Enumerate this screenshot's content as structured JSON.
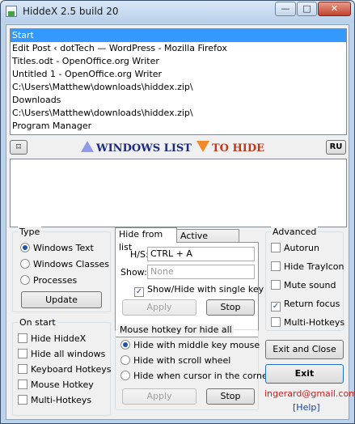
{
  "window": {
    "title": "HiddeX 2.5 build 20",
    "controls": {
      "minimize": "—",
      "maximize": "□",
      "close": "✕"
    }
  },
  "windows_list": {
    "items": [
      "Start",
      "Edit Post ‹ dotTech — WordPress - Mozilla Firefox",
      "Titles.odt - OpenOffice.org Writer",
      "Untitled 1 - OpenOffice.org Writer",
      "C:\\Users\\Matthew\\downloads\\hiddex.zip\\",
      "Downloads",
      "C:\\Users\\Matthew\\downloads\\hiddex.zip\\",
      "Program Manager"
    ],
    "selected_index": 0
  },
  "banner": {
    "windows_list": "WINDOWS LIST",
    "to_hide": "TO HIDE",
    "left_button": "⌑",
    "lang_button": "RU"
  },
  "type": {
    "title": "Type",
    "options": [
      "Windows Text",
      "Windows Classes",
      "Processes"
    ],
    "selected_index": 0,
    "update_label": "Update"
  },
  "on_start": {
    "title": "On start",
    "options": [
      "Hide HiddeX",
      "Hide all windows",
      "Keyboard Hotkeys",
      "Mouse Hotkey",
      "Multi-Hotkeys"
    ]
  },
  "tabs": {
    "hide_from_list": "Hide from list",
    "active_window": "Active window"
  },
  "hotkeys": {
    "hs_label": "H/S:",
    "hs_value": "CTRL + A",
    "show_label": "Show:",
    "show_placeholder": "None",
    "single_key_label": "Show/Hide with single key",
    "single_key_checked": true,
    "apply_label": "Apply",
    "stop_label": "Stop"
  },
  "mouse_hotkey": {
    "title": "Mouse hotkey for hide all",
    "options": [
      "Hide with middle key mouse",
      "Hide with scroll wheel",
      "Hide when cursor in the corner"
    ],
    "selected_index": 0,
    "apply_label": "Apply",
    "stop_label": "Stop"
  },
  "advanced": {
    "title": "Advanced",
    "options": [
      {
        "label": "Autorun",
        "checked": false
      },
      {
        "label": "Hide TrayIcon",
        "checked": false
      },
      {
        "label": "Mute sound",
        "checked": false
      },
      {
        "label": "Return focus",
        "checked": true
      },
      {
        "label": "Multi-Hotkeys",
        "checked": false
      }
    ]
  },
  "actions": {
    "exit_and_close": "Exit and Close",
    "exit": "Exit",
    "email": "ingerard@gmail.com",
    "help": "[Help]"
  }
}
